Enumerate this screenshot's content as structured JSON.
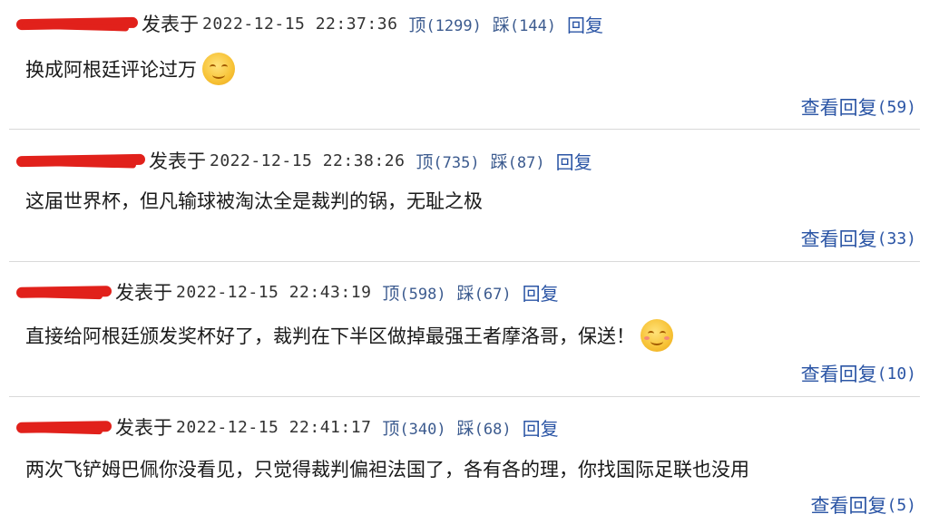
{
  "labels": {
    "posted_at": "发表于",
    "upvote": "顶",
    "downvote": "踩",
    "reply": "回复",
    "view_replies": "查看回复"
  },
  "comments": [
    {
      "time": "2022-12-15 22:37:36",
      "upvotes": "(1299)",
      "downvotes": "(144)",
      "text": "换成阿根廷评论过万",
      "emoji": "smirk-emoji",
      "reply_count": "(59)"
    },
    {
      "time": "2022-12-15 22:38:26",
      "upvotes": "(735)",
      "downvotes": "(87)",
      "text": "这届世界杯，但凡输球被淘汰全是裁判的锅，无耻之极",
      "emoji": "",
      "reply_count": "(33)"
    },
    {
      "time": "2022-12-15 22:43:19",
      "upvotes": "(598)",
      "downvotes": "(67)",
      "text": "直接给阿根廷颁发奖杯好了，裁判在下半区做掉最强王者摩洛哥，保送！",
      "emoji": "smile-emoji",
      "reply_count": "(10)"
    },
    {
      "time": "2022-12-15 22:41:17",
      "upvotes": "(340)",
      "downvotes": "(68)",
      "text": "两次飞铲姆巴佩你没看见，只觉得裁判偏袒法国了，各有各的理，你找国际足联也没用",
      "emoji": "",
      "reply_count": "(5)"
    }
  ],
  "colors": {
    "link": "#2b55a5",
    "vote": "#3c5b8f",
    "redaction": "#e1211b",
    "divider": "#d9d9d9"
  }
}
